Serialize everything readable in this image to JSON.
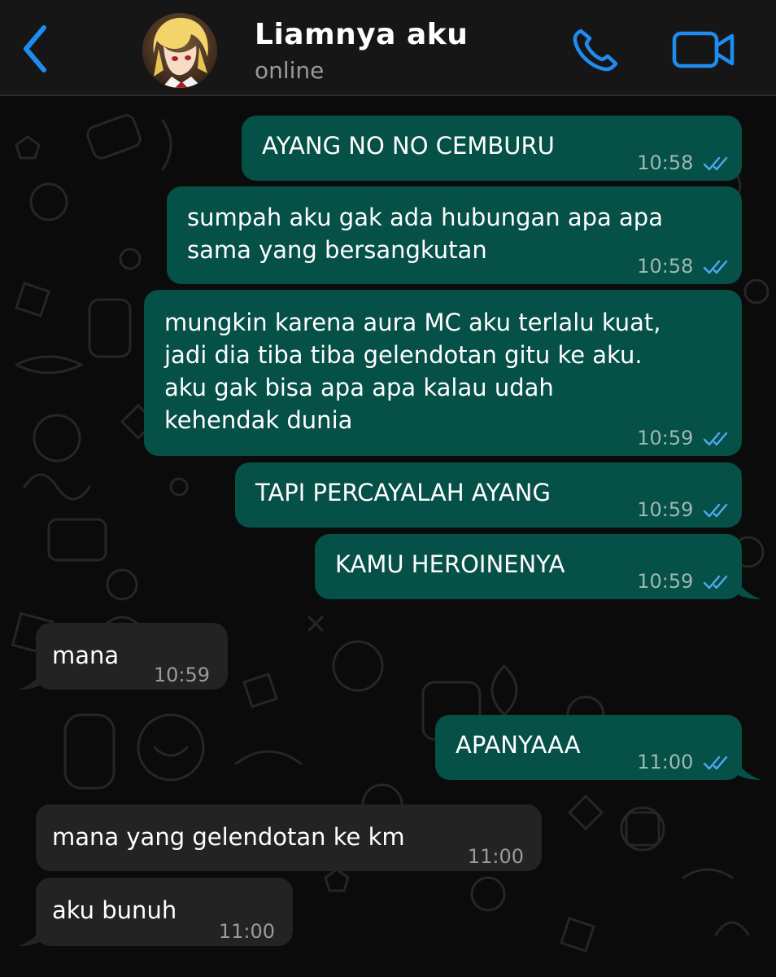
{
  "header": {
    "contact_name": "Liamnya aku",
    "status": "online"
  },
  "icons": {
    "back": "chevron-left-icon",
    "call": "phone-icon",
    "video": "video-camera-icon",
    "read_receipt": "double-check-icon"
  },
  "colors": {
    "accent": "#1e8cf0",
    "outgoing_bubble": "#055047",
    "incoming_bubble": "#232323",
    "read_ticks": "#4fa9f0"
  },
  "messages": [
    {
      "direction": "out",
      "text": "AYANG NO NO CEMBURU",
      "time": "10:58",
      "read": true
    },
    {
      "direction": "out",
      "text": "sumpah aku gak ada hubungan apa apa\nsama yang bersangkutan",
      "time": "10:58",
      "read": true
    },
    {
      "direction": "out",
      "text": "mungkin karena aura MC aku terlalu kuat,\njadi dia tiba tiba gelendotan gitu ke aku.\naku gak bisa apa apa kalau udah\nkehendak dunia",
      "time": "10:59",
      "read": true
    },
    {
      "direction": "out",
      "text": "TAPI PERCAYALAH AYANG",
      "time": "10:59",
      "read": true
    },
    {
      "direction": "out",
      "text": "KAMU HEROINENYA",
      "time": "10:59",
      "read": true
    },
    {
      "direction": "in",
      "text": "mana",
      "time": "10:59"
    },
    {
      "direction": "out",
      "text": "APANYAAA",
      "time": "11:00",
      "read": true
    },
    {
      "direction": "in",
      "text": "mana yang gelendotan ke km",
      "time": "11:00"
    },
    {
      "direction": "in",
      "text": "aku bunuh",
      "time": "11:00"
    }
  ]
}
